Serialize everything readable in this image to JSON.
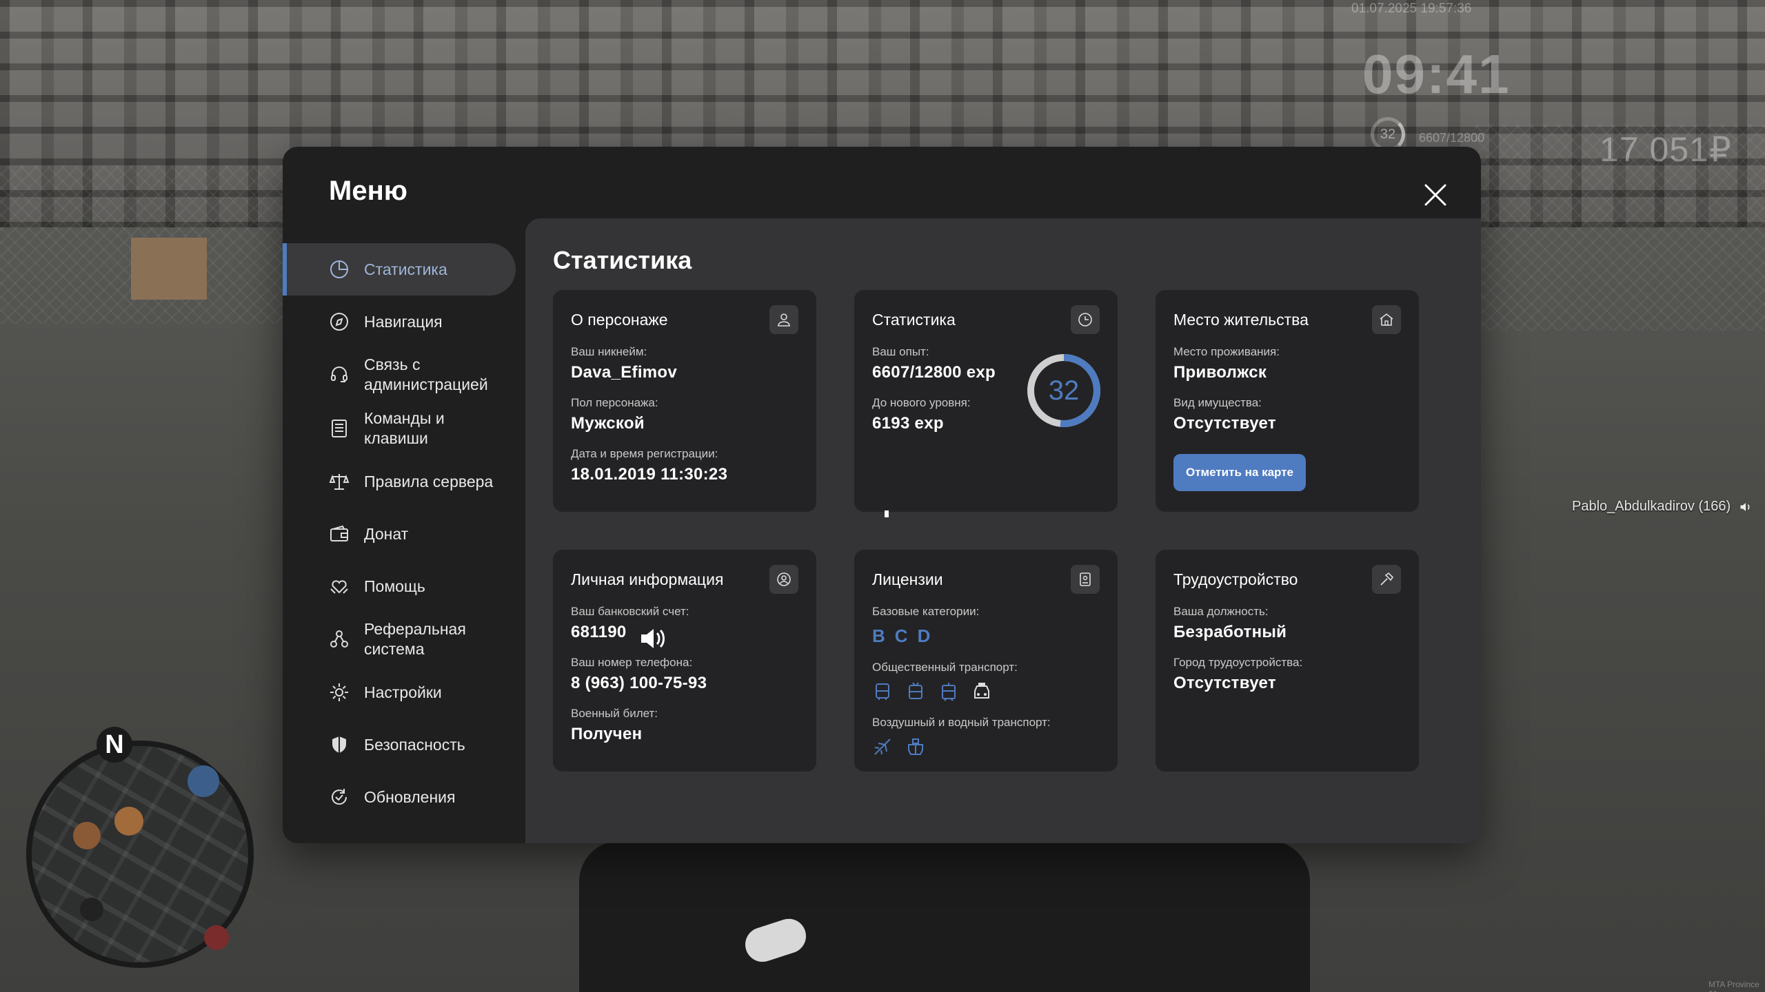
{
  "hud": {
    "datetime": "01.07.2025 19:57:36",
    "clock": "09:41",
    "level": "32",
    "exp": "6607/12800",
    "money": "17 051₽",
    "player_tag": "Pablo_Abdulkadirov (166)",
    "corner": "MTA Province 01",
    "minimap_north": "N"
  },
  "menu": {
    "title": "Меню",
    "nav": [
      {
        "label": "Статистика",
        "icon": "pie-chart-icon",
        "active": true
      },
      {
        "label": "Навигация",
        "icon": "compass-icon"
      },
      {
        "label": "Связь с администрацией",
        "icon": "headset-icon"
      },
      {
        "label": "Команды и клавиши",
        "icon": "document-list-icon"
      },
      {
        "label": "Правила сервера",
        "icon": "scales-icon"
      },
      {
        "label": "Донат",
        "icon": "wallet-icon"
      },
      {
        "label": "Помощь",
        "icon": "heart-hands-icon"
      },
      {
        "label": "Реферальная система",
        "icon": "referral-network-icon"
      },
      {
        "label": "Настройки",
        "icon": "gear-icon"
      },
      {
        "label": "Безопасность",
        "icon": "shield-icon"
      },
      {
        "label": "Обновления",
        "icon": "refresh-check-icon"
      }
    ]
  },
  "content": {
    "title": "Статистика",
    "character": {
      "title": "О персонаже",
      "nick_label": "Ваш никнейм:",
      "nick": "Dava_Efimov",
      "gender_label": "Пол персонажа:",
      "gender": "Мужской",
      "reg_label": "Дата и время регистрации:",
      "reg": "18.01.2019 11:30:23"
    },
    "stats": {
      "title": "Статистика",
      "exp_label": "Ваш опыт:",
      "exp": "6607/12800 exp",
      "next_label": "До нового уровня:",
      "next": "6193 exp",
      "level": "32",
      "level_progress": 0.516
    },
    "residence": {
      "title": "Место жительства",
      "place_label": "Место проживания:",
      "place": "Приволжск",
      "property_label": "Вид имущества:",
      "property": "Отсутствует",
      "button": "Отметить на карте"
    },
    "personal": {
      "title": "Личная информация",
      "bank_label": "Ваш банковский счет:",
      "bank": "681190",
      "phone_label": "Ваш номер телефона:",
      "phone": "8 (963) 100-75-93",
      "military_label": "Военный билет:",
      "military": "Получен"
    },
    "licenses": {
      "title": "Лицензии",
      "base_label": "Базовые категории:",
      "base": [
        "B",
        "C",
        "D"
      ],
      "public_label": "Общественный транспорт:",
      "public_icons": [
        "bus-icon",
        "trolleybus-icon",
        "tram-icon",
        "taxi-icon"
      ],
      "air_label": "Воздушный и водный транспорт:",
      "air_icons": [
        "plane-icon",
        "boat-icon"
      ]
    },
    "job": {
      "title": "Трудоустройство",
      "position_label": "Ваша должность:",
      "position": "Безработный",
      "city_label": "Город трудоустройства:",
      "city": "Отсутствует"
    }
  },
  "colors": {
    "accent": "#4f7bc0",
    "panel": "#1f1f20",
    "content": "#343436",
    "card": "#232325"
  }
}
